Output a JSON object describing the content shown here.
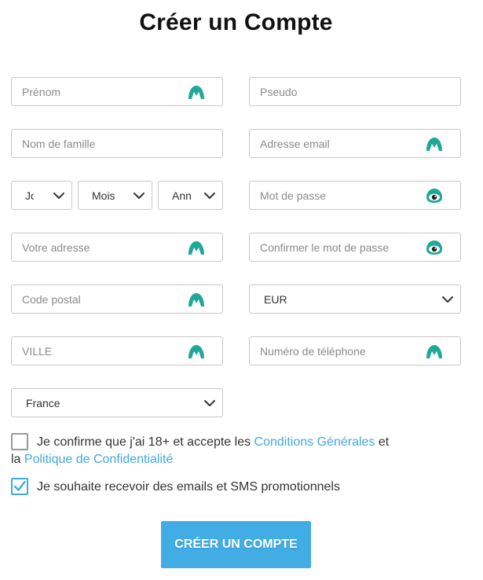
{
  "title": "Créer un Compte",
  "form": {
    "first_name": {
      "placeholder": "Prénom",
      "icon": "mountain-icon"
    },
    "pseudo": {
      "placeholder": "Pseudo"
    },
    "last_name": {
      "placeholder": "Nom de famille",
      "icon": "mountain-icon"
    },
    "email": {
      "placeholder": "Adresse email",
      "icon": "mountain-icon"
    },
    "day": {
      "value": "Jour"
    },
    "month": {
      "value": "Mois"
    },
    "year": {
      "value": "Année"
    },
    "password": {
      "placeholder": "Mot de passe",
      "icon": "eye-icon"
    },
    "address": {
      "placeholder": "Votre adresse",
      "icon": "mountain-icon"
    },
    "confirm_password": {
      "placeholder": "Confirmer le mot de passe",
      "icon": "eye-icon"
    },
    "postal_code": {
      "placeholder": "Code postal",
      "icon": "mountain-icon"
    },
    "currency": {
      "value": "EUR"
    },
    "city": {
      "placeholder": "VILLE",
      "icon": "mountain-icon"
    },
    "phone": {
      "placeholder": "Numéro de téléphone",
      "icon": "mountain-icon"
    },
    "country": {
      "value": "France"
    }
  },
  "terms": {
    "checked": false,
    "text_before": "Je confirme que j'ai 18+ et accepte les ",
    "link_conditions": "Conditions Générales",
    "text_middle": " et",
    "text_line2_prefix": "la ",
    "link_privacy": "Politique de Confidentialité"
  },
  "promo": {
    "checked": true,
    "text": "Je souhaite recevoir des emails et SMS promotionnels"
  },
  "submit_label": "CRÉER UN COMPTE",
  "colors": {
    "accent": "#41ade4",
    "icon_teal": "#1fa79a",
    "border": "#c8c8c8"
  }
}
